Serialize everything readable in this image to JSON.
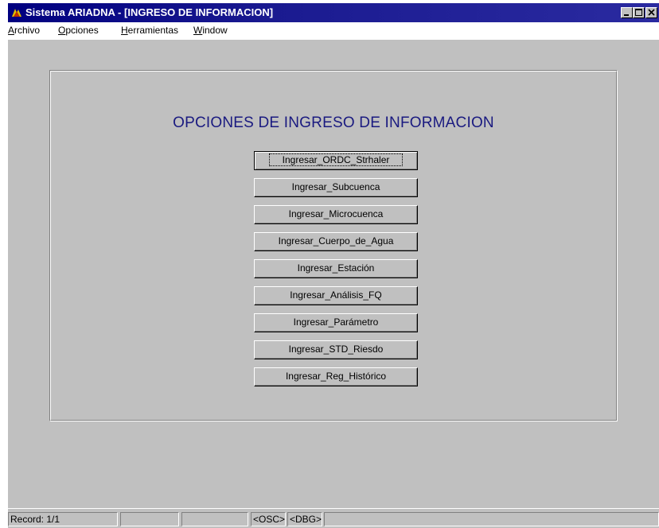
{
  "window": {
    "title": "Sistema ARIADNA - [INGRESO DE INFORMACION]",
    "icon": "ariadna-app-icon",
    "controls": [
      "minimize-icon",
      "maximize-icon",
      "close-icon"
    ]
  },
  "menubar": {
    "items": [
      {
        "key": "A",
        "rest": "rchivo"
      },
      {
        "key": "O",
        "rest": "pciones"
      },
      {
        "key": "H",
        "rest": "erramientas"
      },
      {
        "key": "W",
        "rest": "indow"
      }
    ]
  },
  "main": {
    "heading": "OPCIONES DE INGRESO DE INFORMACION",
    "buttons": [
      "Ingresar_ORDC_Strhaler",
      "Ingresar_Subcuenca",
      "Ingresar_Microcuenca",
      "Ingresar_Cuerpo_de_Agua",
      "Ingresar_Estación",
      "Ingresar_Análisis_FQ",
      "Ingresar_Parámetro",
      "Ingresar_STD_Riesdo",
      "Ingresar_Reg_Histórico"
    ]
  },
  "statusbar": {
    "record": "Record: 1/1",
    "field2": "",
    "field3": "",
    "osc": "<OSC>",
    "dbg": "<DBG>",
    "field6": ""
  },
  "colors": {
    "titlebar": "#000080",
    "heading": "#1a1a80",
    "face": "#c0c0c0"
  }
}
